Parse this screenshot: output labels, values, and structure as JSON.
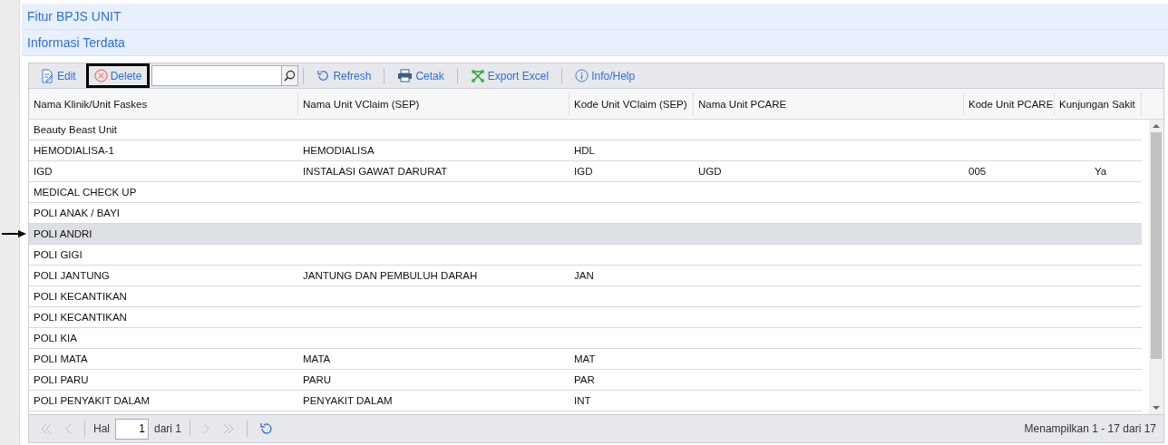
{
  "section_title": "Fitur BPJS UNIT",
  "panel_title": "Informasi Terdata",
  "toolbar": [
    {
      "kind": "edit",
      "label": "Edit",
      "highlighted": false
    },
    {
      "kind": "delete",
      "label": "Delete",
      "highlighted": true
    },
    {
      "kind": "search"
    },
    {
      "kind": "refresh",
      "label": "Refresh",
      "highlighted": false
    },
    {
      "kind": "print",
      "label": "Cetak",
      "highlighted": false
    },
    {
      "kind": "excel",
      "label": "Export Excel",
      "highlighted": false
    },
    {
      "kind": "info",
      "label": "Info/Help",
      "highlighted": false
    }
  ],
  "table": {
    "columns": [
      {
        "label": "Nama Klinik/Unit Faskes"
      },
      {
        "label": "Nama Unit VClaim (SEP)"
      },
      {
        "label": "Kode Unit VClaim (SEP)"
      },
      {
        "label": "Nama Unit PCARE"
      },
      {
        "label": "Kode Unit PCARE"
      },
      {
        "label": "Kunjungan Sakit"
      }
    ],
    "rows": [
      {
        "selected": false,
        "pointer": false,
        "cells": [
          "Beauty Beast Unit",
          "",
          "",
          "",
          "",
          ""
        ]
      },
      {
        "selected": false,
        "pointer": false,
        "cells": [
          "HEMODIALISA-1",
          "HEMODIALISA",
          "HDL",
          "",
          "",
          ""
        ]
      },
      {
        "selected": false,
        "pointer": false,
        "cells": [
          "IGD",
          "INSTALASI GAWAT DARURAT",
          "IGD",
          "UGD",
          "005",
          "Ya"
        ]
      },
      {
        "selected": false,
        "pointer": false,
        "cells": [
          "MEDICAL CHECK UP",
          "",
          "",
          "",
          "",
          ""
        ]
      },
      {
        "selected": false,
        "pointer": false,
        "cells": [
          "POLI ANAK / BAYI",
          "",
          "",
          "",
          "",
          ""
        ]
      },
      {
        "selected": true,
        "pointer": true,
        "cells": [
          "POLI ANDRI",
          "",
          "",
          "",
          "",
          ""
        ]
      },
      {
        "selected": false,
        "pointer": false,
        "cells": [
          "POLI GIGI",
          "",
          "",
          "",
          "",
          ""
        ]
      },
      {
        "selected": false,
        "pointer": false,
        "cells": [
          "POLI JANTUNG",
          "JANTUNG DAN PEMBULUH DARAH",
          "JAN",
          "",
          "",
          ""
        ]
      },
      {
        "selected": false,
        "pointer": false,
        "cells": [
          "POLI KECANTIKAN",
          "",
          "",
          "",
          "",
          ""
        ]
      },
      {
        "selected": false,
        "pointer": false,
        "cells": [
          "POLI KECANTIKAN",
          "",
          "",
          "",
          "",
          ""
        ]
      },
      {
        "selected": false,
        "pointer": false,
        "cells": [
          "POLI KIA",
          "",
          "",
          "",
          "",
          ""
        ]
      },
      {
        "selected": false,
        "pointer": false,
        "cells": [
          "POLI MATA",
          "MATA",
          "MAT",
          "",
          "",
          ""
        ]
      },
      {
        "selected": false,
        "pointer": false,
        "cells": [
          "POLI PARU",
          "PARU",
          "PAR",
          "",
          "",
          ""
        ]
      },
      {
        "selected": false,
        "pointer": false,
        "cells": [
          "POLI PENYAKIT DALAM",
          "PENYAKIT DALAM",
          "INT",
          "",
          "",
          ""
        ]
      }
    ]
  },
  "pager": {
    "page_label": "Hal",
    "page": "1",
    "of_label": "dari 1",
    "summary": "Menampilkan 1 - 17 dari 17"
  }
}
